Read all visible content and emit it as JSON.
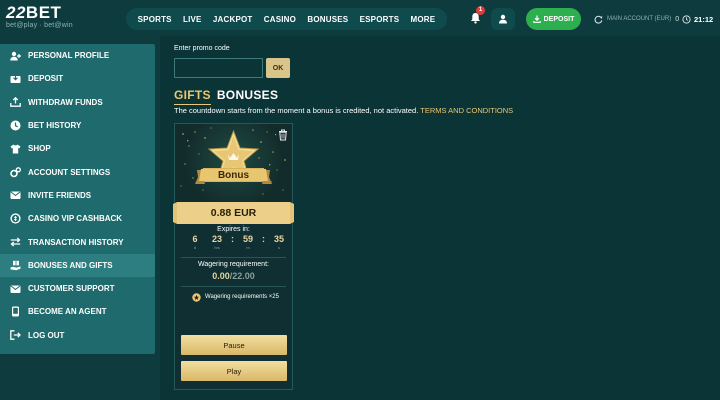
{
  "brand": {
    "logo_number": "22",
    "logo_word": "BET",
    "tagline": "bet@play · bet@win"
  },
  "nav": {
    "items": [
      "SPORTS",
      "LIVE",
      "JACKPOT",
      "CASINO",
      "BONUSES",
      "ESPORTS",
      "MORE"
    ]
  },
  "header": {
    "notification_count": "1",
    "deposit_label": "DEPOSIT",
    "account_label": "MAIN ACCOUNT (EUR)",
    "account_value": "0",
    "time": "21:12"
  },
  "sidebar": {
    "items": [
      {
        "label": "PERSONAL PROFILE",
        "icon": "user-plus-icon"
      },
      {
        "label": "DEPOSIT",
        "icon": "deposit-icon"
      },
      {
        "label": "WITHDRAW FUNDS",
        "icon": "withdraw-icon"
      },
      {
        "label": "BET HISTORY",
        "icon": "clock-icon"
      },
      {
        "label": "SHOP",
        "icon": "shirt-icon"
      },
      {
        "label": "ACCOUNT SETTINGS",
        "icon": "settings-icon"
      },
      {
        "label": "INVITE FRIENDS",
        "icon": "invite-icon"
      },
      {
        "label": "CASINO VIP CASHBACK",
        "icon": "cashback-icon"
      },
      {
        "label": "TRANSACTION HISTORY",
        "icon": "transfer-icon"
      },
      {
        "label": "BONUSES AND GIFTS",
        "icon": "gift-hand-icon",
        "active": true
      },
      {
        "label": "CUSTOMER SUPPORT",
        "icon": "mail-icon"
      },
      {
        "label": "BECOME AN AGENT",
        "icon": "phone-icon"
      },
      {
        "label": "LOG OUT",
        "icon": "logout-icon"
      }
    ]
  },
  "promo": {
    "label": "Enter promo code",
    "value": "",
    "placeholder": "",
    "ok_label": "OK"
  },
  "tabs": {
    "gifts": "GIFTS",
    "bonuses": "BONUSES"
  },
  "notice": {
    "text": "The countdown starts from the moment a bonus is credited, not activated.",
    "link": "TERMS AND CONDITIONS"
  },
  "bonus_card": {
    "badge_text": "Bonus",
    "amount": "0.88 EUR",
    "expires_label": "Expires in:",
    "timer": {
      "days": "6",
      "hours": "23",
      "minutes": "59",
      "seconds": "35",
      "days_unit": "d",
      "hours_unit": "hrs",
      "minutes_unit": "m",
      "seconds_unit": "s"
    },
    "wagering_label": "Wagering requirement:",
    "wagering_done": "0.00",
    "wagering_sep": "/",
    "wagering_total": "22.00",
    "wagering_note": "Wagering requirements ×25",
    "pause_label": "Pause",
    "play_label": "Play"
  },
  "colors": {
    "background": "#0d3b3e",
    "sidebar": "#1f6a6c",
    "sidebar_active": "#2d7e80",
    "gold": "#e9c774",
    "deposit_green": "#2dae4f"
  }
}
